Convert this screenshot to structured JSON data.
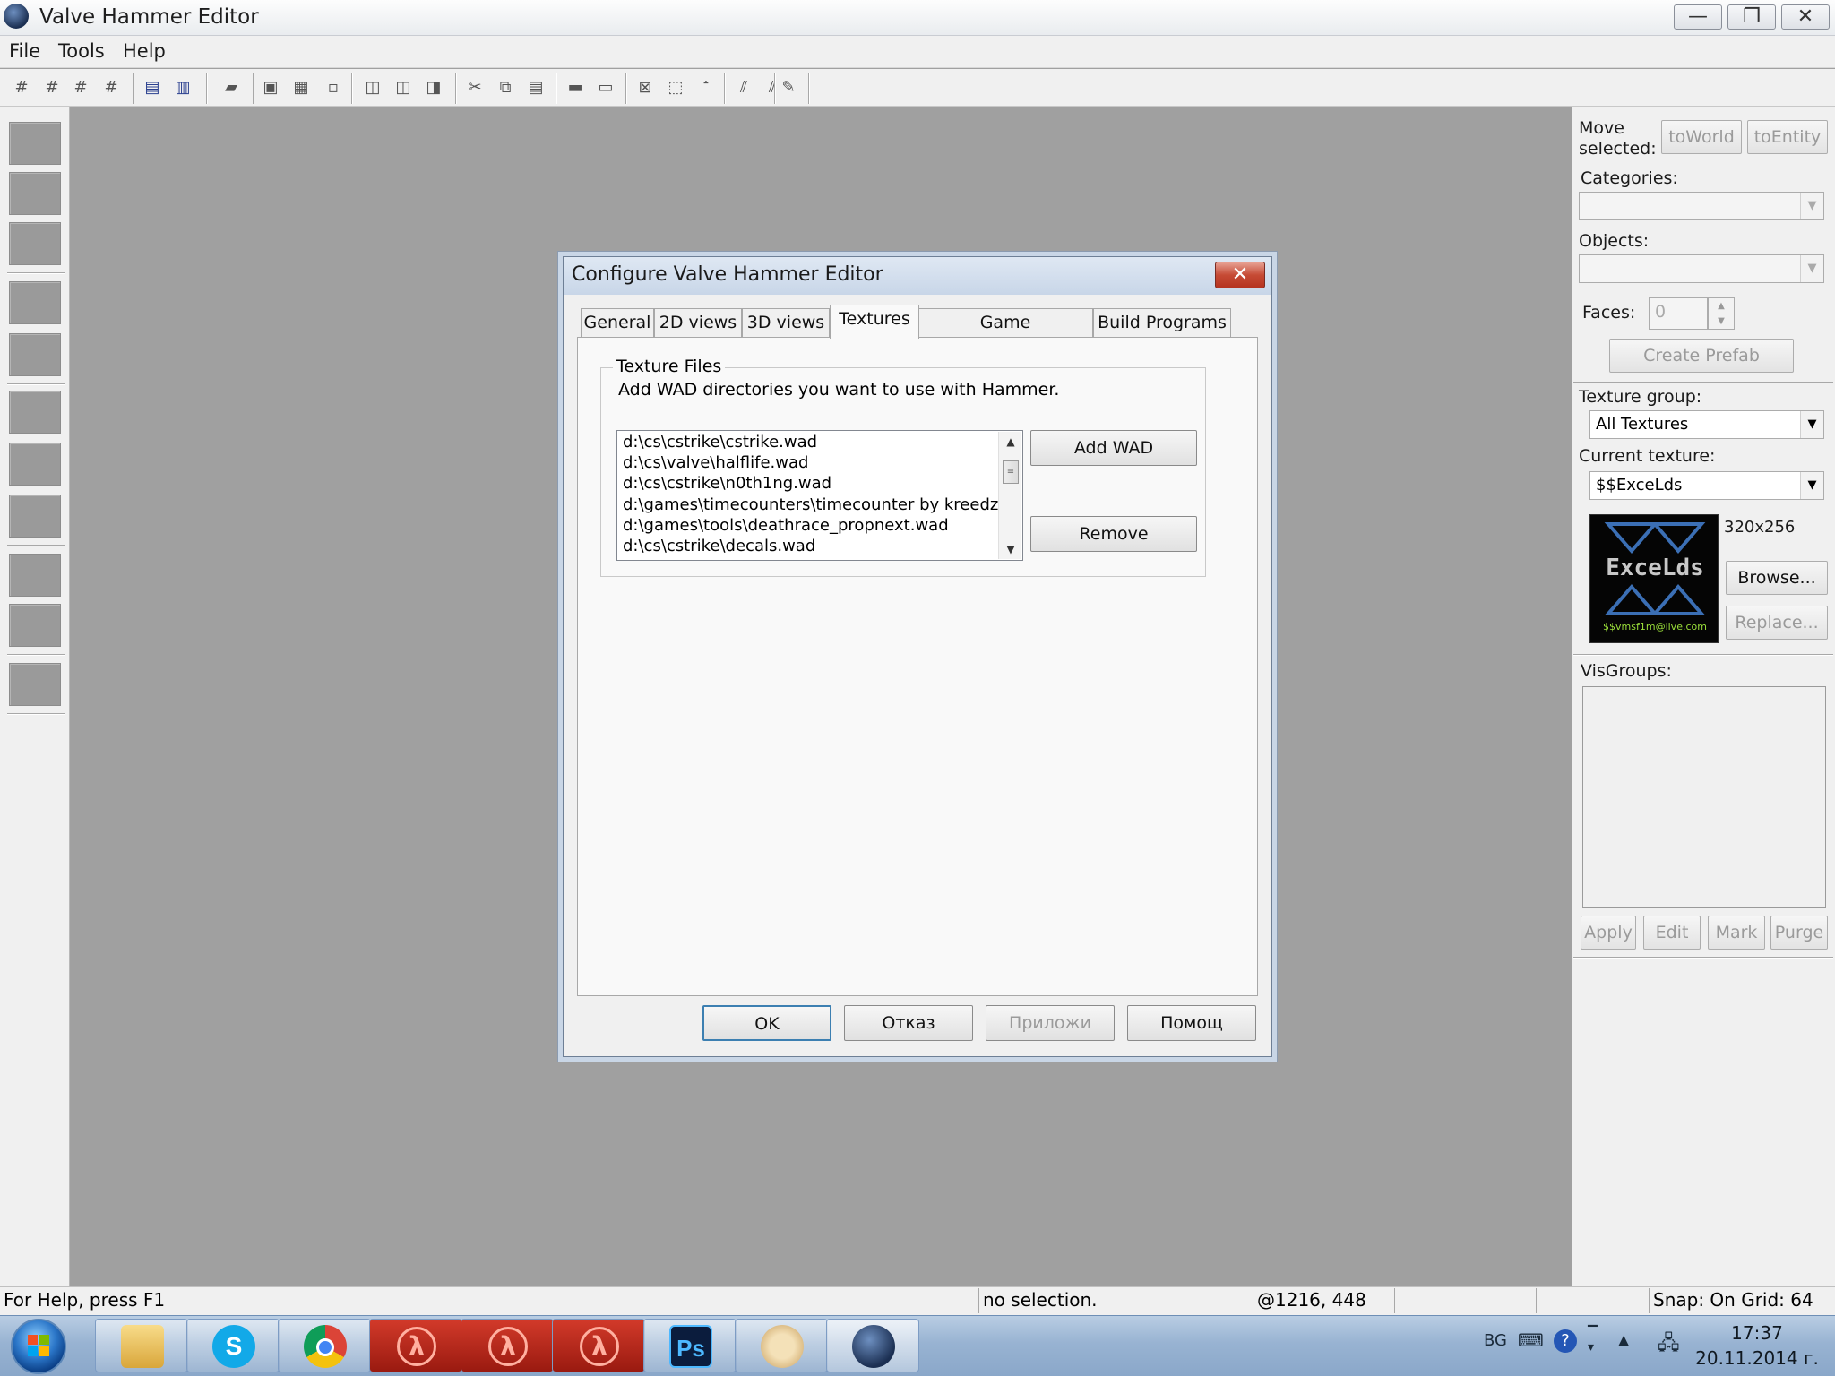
{
  "window": {
    "title": "Valve Hammer Editor",
    "minimize": "—",
    "restore": "❐",
    "close": "✕"
  },
  "menu": {
    "items": [
      "File",
      "Tools",
      "Help"
    ]
  },
  "toolbar": {
    "icons": [
      "grid-icon",
      "grid-smaller-icon",
      "grid-larger-icon",
      "grid-toggle-icon",
      "group-icon",
      "ungroup-icon",
      "hide-icon",
      "carve-icon",
      "hollow-icon",
      "texture-lock-icon",
      "undo-icon",
      "redo-icon",
      "copy-icon",
      "cut-icon",
      "copy-clipboard-icon",
      "paste-icon",
      "tie-entity-icon",
      "move-to-world-icon",
      "check-icon",
      "select-icon",
      "texture-icon",
      "run-map-icon",
      "flip-icon",
      "settings-icon"
    ]
  },
  "right_panel": {
    "move_selected_label_1": "Move",
    "move_selected_label_2": "selected:",
    "to_world_button": "toWorld",
    "to_entity_button": "toEntity",
    "categories_label": "Categories:",
    "objects_label": "Objects:",
    "faces_label": "Faces:",
    "faces_value": "0",
    "create_prefab_button": "Create Prefab",
    "texture_group_label": "Texture group:",
    "texture_group_value": "All Textures",
    "current_texture_label": "Current texture:",
    "current_texture_value": "$$ExceLds",
    "texture_size": "320x256",
    "texture_preview_text": "ExceLds",
    "texture_preview_subtext": "$$vmsf1m@live.com",
    "browse_button": "Browse...",
    "replace_button": "Replace...",
    "visgroups_label": "VisGroups:",
    "apply_button": "Apply",
    "edit_button": "Edit",
    "mark_button": "Mark",
    "purge_button": "Purge"
  },
  "dialog": {
    "title": "Configure Valve Hammer Editor",
    "close": "✕",
    "tabs": [
      "General",
      "2D views",
      "3D views",
      "Textures",
      "Game Configurations",
      "Build Programs"
    ],
    "active_tab": "Textures",
    "group_title": "Texture Files",
    "group_description": "Add WAD directories you want to use with Hammer.",
    "wad_files": [
      "d:\\cs\\cstrike\\cstrike.wad",
      "d:\\cs\\valve\\halflife.wad",
      "d:\\cs\\cstrike\\n0th1ng.wad",
      "d:\\games\\timecounters\\timecounter by kreedz\\ti",
      "d:\\games\\tools\\deathrace_propnext.wad",
      "d:\\cs\\cstrike\\decals.wad"
    ],
    "add_wad_button": "Add WAD",
    "remove_button": "Remove",
    "ok_button": "OK",
    "cancel_button": "Отказ",
    "apply_button": "Приложи",
    "help_button": "Помощ"
  },
  "statusbar": {
    "help_text": "For Help, press F1",
    "selection": "no selection.",
    "coords": "@1216, 448",
    "snap": "Snap: On Grid: 64"
  },
  "taskbar": {
    "apps": [
      "file-explorer",
      "skype",
      "chrome",
      "half-life",
      "half-life",
      "half-life",
      "photoshop",
      "paint",
      "hammer-editor"
    ],
    "ps_label": "Ps",
    "tray_lang": "BG",
    "time": "17:37",
    "date": "20.11.2014 г."
  },
  "colors": {
    "dialog_border": "#8b9bb0",
    "close_red": "#c64b35",
    "workspace": "#a0a0a0",
    "taskbar": "#98b3d2"
  }
}
